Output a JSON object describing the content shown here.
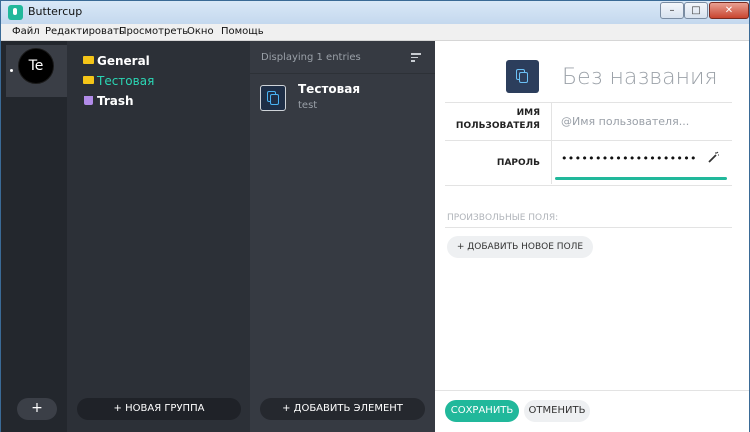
{
  "window": {
    "title": "Buttercup",
    "controls": {
      "minimize": "–",
      "maximize": "□",
      "close": "✕"
    }
  },
  "menu": [
    "Файл",
    "Редактировать",
    "Просмотреть",
    "Окно",
    "Помощь"
  ],
  "archives": {
    "items": [
      {
        "initials": "Te"
      }
    ],
    "add_label": "+"
  },
  "groups": {
    "items": [
      {
        "label": "General",
        "icon": "folder-icon"
      },
      {
        "label": "Тестовая",
        "icon": "folder-icon",
        "active": true
      },
      {
        "label": "Trash",
        "icon": "trash-icon"
      }
    ],
    "new_group_label": "+ НОВАЯ ГРУППА"
  },
  "entries": {
    "count_label": "Displaying 1 entries",
    "items": [
      {
        "title": "Тестовая",
        "subtitle": "test"
      }
    ],
    "add_label": "+ ДОБАВИТЬ ЭЛЕМЕНТ"
  },
  "details": {
    "title": "Без названия",
    "username_label_1": "ИМЯ",
    "username_label_2": "ПОЛЬЗОВАТЕЛЯ",
    "username_placeholder": "@Имя пользователя...",
    "password_label": "ПАРОЛЬ",
    "password_value": "••••••••••••••••••••",
    "custom_fields_label": "ПРОИЗВОЛЬНЫЕ ПОЛЯ:",
    "add_field_label": "+ ДОБАВИТЬ НОВОЕ ПОЛЕ",
    "save_label": "СОХРАНИТЬ",
    "cancel_label": "ОТМЕНИТЬ"
  },
  "colors": {
    "accent": "#21b89b",
    "active_group": "#2bd6b4",
    "folder": "#f5c518",
    "trash": "#b18be8"
  }
}
